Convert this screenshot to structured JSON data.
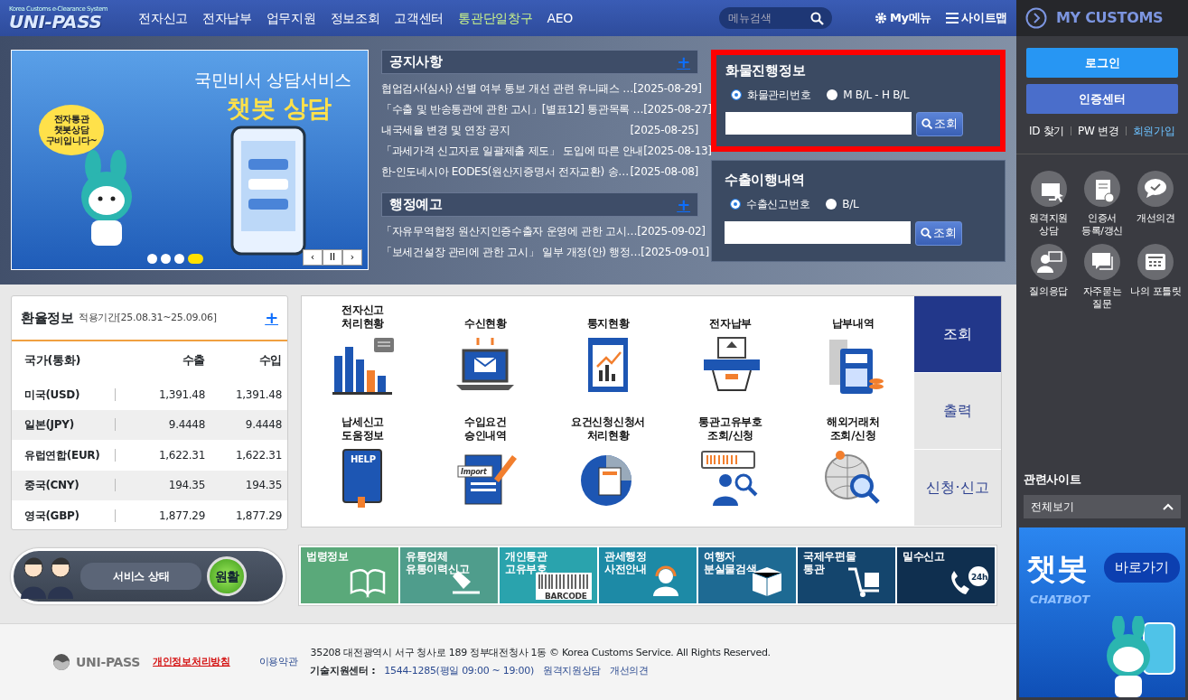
{
  "header": {
    "logo": "UNI-PASS",
    "tagline": "Korea Customs e-Clearance System",
    "menu": [
      {
        "label": "전자신고",
        "highlighted": false
      },
      {
        "label": "전자납부",
        "highlighted": false
      },
      {
        "label": "업무지원",
        "highlighted": false
      },
      {
        "label": "정보조회",
        "highlighted": false
      },
      {
        "label": "고객센터",
        "highlighted": false
      },
      {
        "label": "통관단일창구",
        "highlighted": true
      },
      {
        "label": "AEO",
        "highlighted": false
      }
    ],
    "search": {
      "placeholder": "메뉴검색"
    },
    "my_menu": "My메뉴",
    "sitemap": "사이트맵"
  },
  "banner": {
    "title": "국민비서 상담서비스",
    "headline": "챗봇 상담",
    "bubble": [
      "전자통관",
      "챗봇상담",
      "구비입니다~"
    ],
    "dots": [
      {
        "selected": false
      },
      {
        "selected": false
      },
      {
        "selected": false
      },
      {
        "selected": true
      }
    ],
    "controls": [
      "‹",
      "II",
      "›"
    ]
  },
  "notices": {
    "title": "공지사항",
    "more": "+",
    "items": [
      {
        "title": "협업검사(심사) 선별 여부 통보 개선 관련 유니패스 …",
        "date": "[2025-08-29]"
      },
      {
        "title": "「수출 및 반송통관에 관한 고시」[별표12] 통관목록 …",
        "date": "[2025-08-27]"
      },
      {
        "title": "내국세율 변경 및 연장 공지",
        "date": "[2025-08-25]"
      },
      {
        "title": "「과세가격 신고자료 일괄제출 제도」 도입에 따른 안내",
        "date": "[2025-08-13]"
      },
      {
        "title": "한-인도네시아 EODES(원산지증명서 전자교환) 송…",
        "date": "[2025-08-08]"
      }
    ]
  },
  "admin_notices": {
    "title": "행정예고",
    "more": "+",
    "items": [
      {
        "title": "「자유무역협정 원산지인증수출자 운영에 관한 고시…",
        "date": "[2025-09-02]"
      },
      {
        "title": "「보세건설장 관리에 관한 고시」 일부 개정(안) 행정…",
        "date": "[2025-09-01]"
      }
    ]
  },
  "lookups": [
    {
      "title": "화물진행정보",
      "highlighted": true,
      "options": [
        {
          "label": "화물관리번호",
          "selected": true
        },
        {
          "label": "M B/L - H B/L",
          "selected": false
        }
      ],
      "button": "조회"
    },
    {
      "title": "수출이행내역",
      "highlighted": false,
      "options": [
        {
          "label": "수출신고번호",
          "selected": true
        },
        {
          "label": "B/L",
          "selected": false
        }
      ],
      "button": "조회"
    }
  ],
  "exchange": {
    "title": "환율정보",
    "period": "적용기간[25.08.31~25.09.06]",
    "more": "+",
    "columns": [
      "국가(통화)",
      "수출",
      "수입"
    ],
    "rows": [
      [
        "미국(USD)",
        "1,391.48",
        "1,391.48"
      ],
      [
        "일본(JPY)",
        "9.4448",
        "9.4448"
      ],
      [
        "유럽연합(EUR)",
        "1,622.31",
        "1,622.31"
      ],
      [
        "중국(CNY)",
        "194.35",
        "194.35"
      ],
      [
        "영국(GBP)",
        "1,877.29",
        "1,877.29"
      ]
    ]
  },
  "services": {
    "items": [
      {
        "label": [
          "전자신고",
          "처리현황"
        ]
      },
      {
        "label": [
          "수신현황"
        ]
      },
      {
        "label": [
          "통지현황"
        ]
      },
      {
        "label": [
          "전자납부"
        ]
      },
      {
        "label": [
          "납부내역"
        ]
      },
      {
        "label": [
          "납세신고",
          "도움정보"
        ]
      },
      {
        "label": [
          "수입요건",
          "승인내역"
        ]
      },
      {
        "label": [
          "요건신청신청서",
          "처리현황"
        ]
      },
      {
        "label": [
          "통관고유부호",
          "조회/신청"
        ]
      },
      {
        "label": [
          "해외거래처",
          "조회/신청"
        ]
      }
    ],
    "help_text": "HELP",
    "import_text": "Import",
    "tabs": [
      {
        "label": "조회",
        "selected": true
      },
      {
        "label": "출력",
        "selected": false
      },
      {
        "label": "신청·신고",
        "selected": false
      }
    ]
  },
  "service_status": {
    "label": "서비스 상태",
    "status": "원활"
  },
  "quick_links": [
    {
      "label": [
        "법령정보"
      ],
      "color": "#5aa97a"
    },
    {
      "label": [
        "유통업체",
        "유통이력신고"
      ],
      "color": "#4f9d8c"
    },
    {
      "label": [
        "개인통관",
        "고유부호"
      ],
      "color": "#2aa3ad",
      "icon_text": "BARCODE"
    },
    {
      "label": [
        "관세행정",
        "사전안내"
      ],
      "color": "#1d8aa6"
    },
    {
      "label": [
        "여행자",
        "분실물검색"
      ],
      "color": "#1e6a93"
    },
    {
      "label": [
        "국제우편물",
        "통관"
      ],
      "color": "#14456d"
    },
    {
      "label": [
        "밀수신고"
      ],
      "color": "#0f2f4f",
      "icon_text": "24h"
    }
  ],
  "footer": {
    "logo": "UNI-PASS",
    "links": [
      {
        "label": "개인정보처리방침",
        "emphasized": true
      },
      {
        "label": "이용약관",
        "emphasized": false
      }
    ],
    "address": "35208 대전광역시 서구 청사로 189 정부대전청사 1동 © Korea Customs Service. All Rights Reserved.",
    "support_label": "기술지원센터 :",
    "support_hours": "1544-1285(평일 09:00 ~ 19:00)",
    "support_links": [
      "원격지원상담",
      "개선의견"
    ]
  },
  "sidebar": {
    "title": "MY CUSTOMS",
    "login": "로그인",
    "cert": "인증센터",
    "account_links": [
      {
        "label": "ID 찾기",
        "highlighted": false
      },
      {
        "label": "PW 변경",
        "highlighted": false
      },
      {
        "label": "회원가입",
        "highlighted": true
      }
    ],
    "shortcuts": [
      {
        "label": [
          "원격지원",
          "상담"
        ]
      },
      {
        "label": [
          "인증서",
          "등록/갱신"
        ]
      },
      {
        "label": [
          "개선의견"
        ]
      },
      {
        "label": [
          "질의응답"
        ]
      },
      {
        "label": [
          "자주묻는",
          "질문"
        ]
      },
      {
        "label": [
          "나의 포틀릿"
        ]
      }
    ],
    "related": {
      "title": "관련사이트",
      "select": "전체보기"
    },
    "chatbot": {
      "title": "챗봇",
      "subtitle": "CHATBOT",
      "button": "바로가기"
    }
  }
}
